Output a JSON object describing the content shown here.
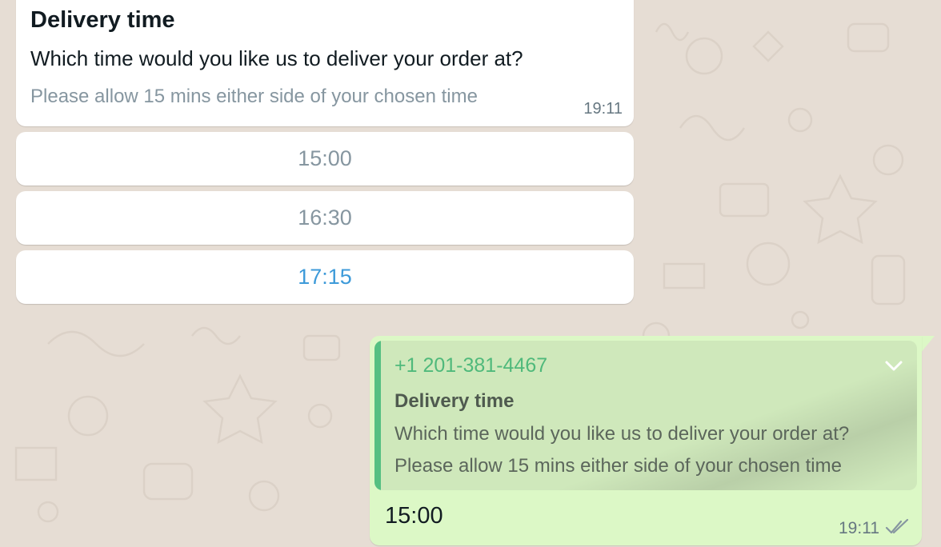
{
  "incoming_message": {
    "title": "Delivery time",
    "body": "Which time would you like us to deliver your order at?",
    "footer": "Please allow 15 mins either side of your chosen time",
    "time": "19:11",
    "reply_buttons": [
      {
        "label": "15:00"
      },
      {
        "label": "16:30"
      },
      {
        "label": "17:15"
      }
    ]
  },
  "outgoing_message": {
    "quoted": {
      "sender": "+1 201-381-4467",
      "title": "Delivery time",
      "body": "Which time would you like us to deliver your order at?",
      "footer": "Please allow 15 mins either side of your chosen time"
    },
    "text": "15:00",
    "time": "19:11",
    "status_icon": "double-check-icon"
  },
  "colors": {
    "wallpaper": "#e6ddd4",
    "incoming_bubble": "#ffffff",
    "outgoing_bubble": "#dcf8c6",
    "quote_bar": "#55c082",
    "sender_name": "#4fb97b",
    "active_button_text": "#3d9ad9"
  }
}
